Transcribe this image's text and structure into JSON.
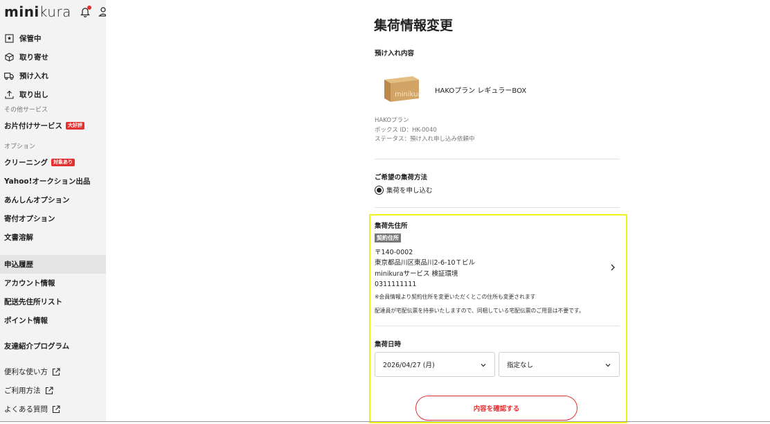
{
  "brand": {
    "logo_bold": "mini",
    "logo_light": "kura"
  },
  "sidebar": {
    "main_items": [
      {
        "label": "保管中",
        "icon": "storage-box-icon"
      },
      {
        "label": "取り寄せ",
        "icon": "package-icon"
      },
      {
        "label": "預け入れ",
        "icon": "truck-icon"
      },
      {
        "label": "取り出し",
        "icon": "upload-icon"
      }
    ],
    "other_services_label": "その他サービス",
    "other_services_item": "お片付けサービス",
    "other_services_badge": "大好評",
    "options_label": "オプション",
    "cleaning_item": "クリーニング",
    "cleaning_badge": "対象あり",
    "yahoo_item": "Yahoo!オークション出品",
    "anshin_item": "あんしんオプション",
    "donation_item": "寄付オプション",
    "document_item": "文書溶解",
    "history_item": "申込履歴",
    "account_item": "アカウント情報",
    "delivery_list_item": "配送先住所リスト",
    "points_item": "ポイント情報",
    "referral_item": "友達紹介プログラム",
    "howto_item": "便利な使い方",
    "usage_item": "ご利用方法",
    "faq_item": "よくある質問"
  },
  "main": {
    "title": "集荷情報変更",
    "deposit_heading": "預け入れ内容",
    "product_name": "HAKOプラン レギュラーBOX",
    "box_logo_text": "minikura",
    "meta_plan": "HAKOプラン",
    "meta_box_id": "ボックス ID：HK-0040",
    "meta_status": "ステータス：預け入れ申し込み依頼中",
    "method_heading": "ご希望の集荷方法",
    "method_option": "集荷を申し込む",
    "address_heading": "集荷先住所",
    "address_tag": "契約住所",
    "postal": "〒140-0002",
    "address_line": "東京都品川区東品川2-6-10Ｔビル",
    "company": "minikuraサービス 検証環境",
    "phone": "0311111111",
    "note_1": "※会員情報より契約住所を変更いただくとこの住所も変更されます",
    "note_2": "配達員が宅配伝票を持参いたしますので、同梱している宅配伝票のご用意は不要です。",
    "date_heading": "集荷日時",
    "date_value": "2026/04/27 (月)",
    "time_value": "指定なし",
    "confirm_label": "内容を確認する"
  },
  "colors": {
    "accent_red": "#e53030",
    "highlight": "#f5f21a",
    "sidebar_bg": "#f3f3f3"
  }
}
